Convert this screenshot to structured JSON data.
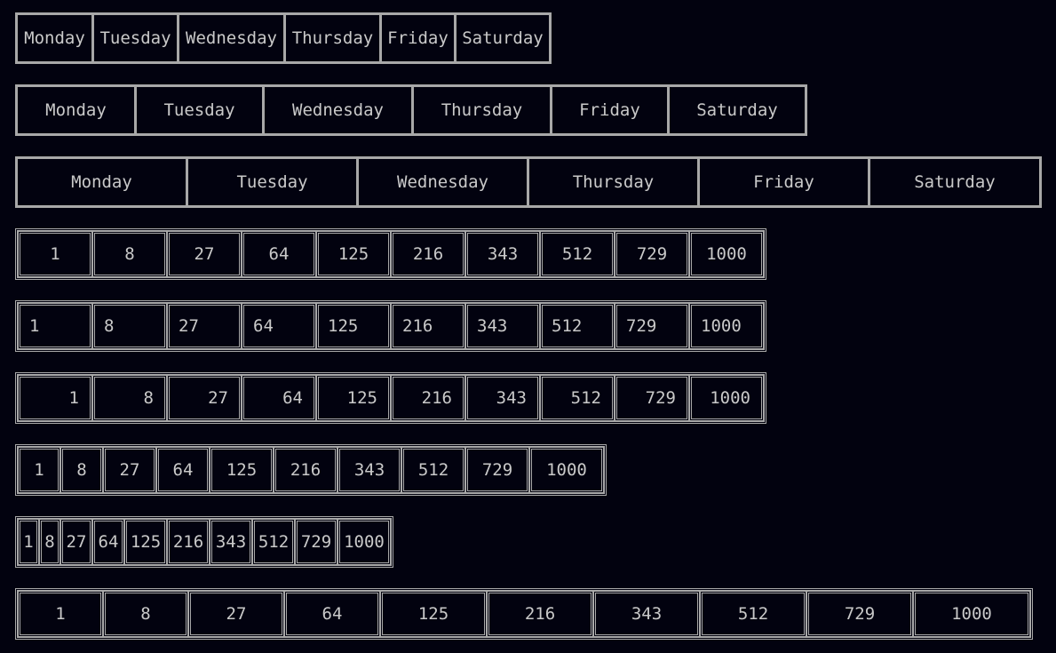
{
  "weekdays": [
    "Monday",
    "Tuesday",
    "Wednesday",
    "Thursday",
    "Friday",
    "Saturday"
  ],
  "cubes": [
    "1",
    "8",
    "27",
    "64",
    "125",
    "216",
    "343",
    "512",
    "729",
    "1000"
  ]
}
